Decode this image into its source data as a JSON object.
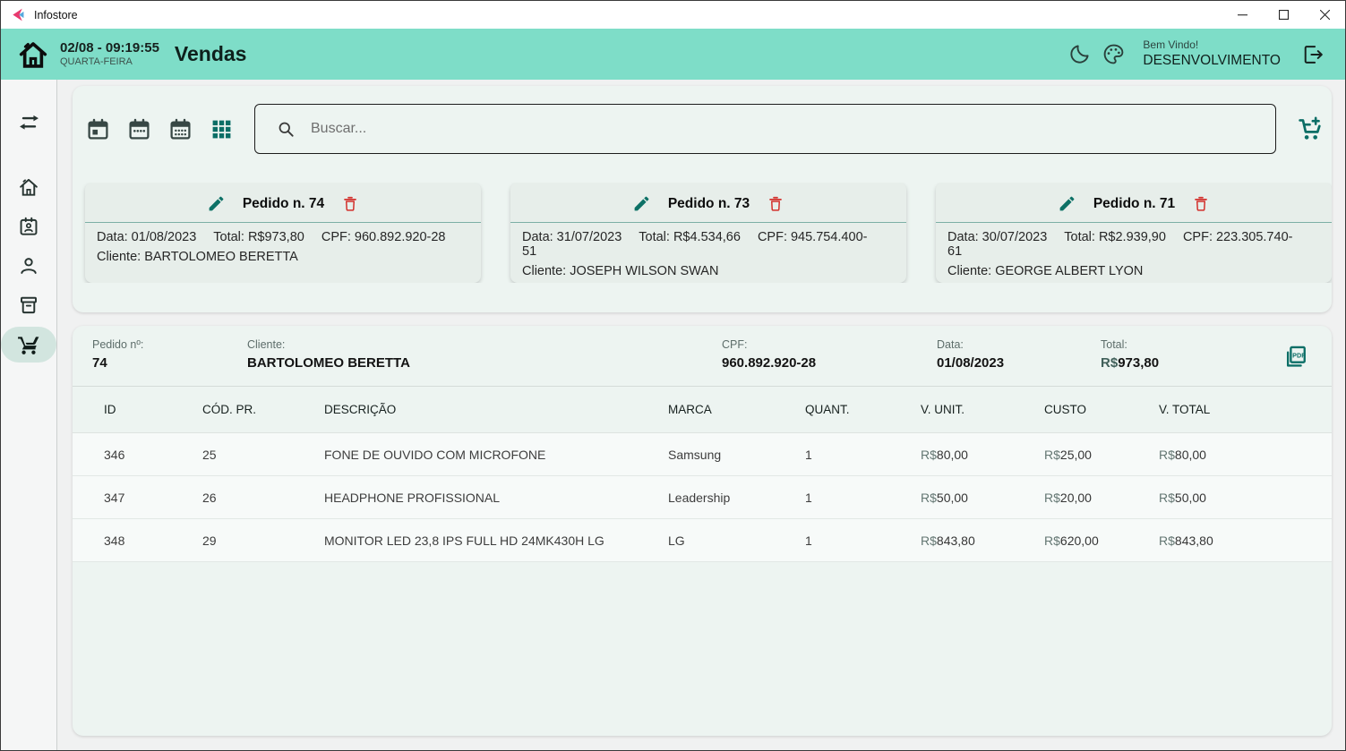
{
  "window": {
    "title": "Infostore",
    "controls": [
      "minimize",
      "maximize",
      "close"
    ]
  },
  "header": {
    "date": "02/08 - 09:19:55",
    "weekday": "QUARTA-FEIRA",
    "title": "Vendas",
    "welcome": "Bem Vindo!",
    "user": "DESENVOLVIMENTO"
  },
  "sidebar": {
    "items": [
      {
        "icon": "swap-horizontal-icon",
        "active": false
      },
      {
        "icon": "home-icon",
        "active": false
      },
      {
        "icon": "contact-badge-icon",
        "active": false
      },
      {
        "icon": "person-icon",
        "active": false
      },
      {
        "icon": "archive-box-icon",
        "active": false
      },
      {
        "icon": "shopping-cart-icon",
        "active": true
      }
    ]
  },
  "toolbar": {
    "icons": [
      "calendar-day-icon",
      "calendar-week-icon",
      "calendar-month-icon",
      "grid-icon",
      "search-icon",
      "add-cart-icon"
    ],
    "search_placeholder": "Buscar..."
  },
  "orders": [
    {
      "title": "Pedido n. 74",
      "data": "Data: 01/08/2023",
      "total": "Total: R$973,80",
      "cpf": "CPF: 960.892.920-28",
      "cliente": "Cliente: BARTOLOMEO BERETTA"
    },
    {
      "title": "Pedido n. 73",
      "data": "Data: 31/07/2023",
      "total": "Total: R$4.534,66",
      "cpf": "CPF: 945.754.400-51",
      "cliente": "Cliente: JOSEPH WILSON SWAN"
    },
    {
      "title": "Pedido n. 71",
      "data": "Data: 30/07/2023",
      "total": "Total: R$2.939,90",
      "cpf": "CPF: 223.305.740-61",
      "cliente": "Cliente: GEORGE ALBERT LYON"
    }
  ],
  "detail": {
    "pedido_label": "Pedido nº:",
    "pedido": "74",
    "cliente_label": "Cliente:",
    "cliente": "BARTOLOMEO BERETTA",
    "cpf_label": "CPF:",
    "cpf": "960.892.920-28",
    "data_label": "Data:",
    "data": "01/08/2023",
    "total_label": "Total:",
    "total_prefix": "R$",
    "total": "973,80",
    "pdf_icon": "pdf-export-icon"
  },
  "table": {
    "headers": [
      "ID",
      "CÓD. PR.",
      "DESCRIÇÃO",
      "MARCA",
      "QUANT.",
      "V. UNIT.",
      "CUSTO",
      "V. TOTAL"
    ],
    "rows": [
      {
        "id": "346",
        "cod": "25",
        "desc": "FONE DE OUVIDO COM MICROFONE",
        "marca": "Samsung",
        "quant": "1",
        "vunit_pre": "R$",
        "vunit": "80,00",
        "custo_pre": "R$",
        "custo": "25,00",
        "vtotal_pre": "R$",
        "vtotal": "80,00"
      },
      {
        "id": "347",
        "cod": "26",
        "desc": "HEADPHONE PROFISSIONAL",
        "marca": "Leadership",
        "quant": "1",
        "vunit_pre": "R$",
        "vunit": "50,00",
        "custo_pre": "R$",
        "custo": "20,00",
        "vtotal_pre": "R$",
        "vtotal": "50,00"
      },
      {
        "id": "348",
        "cod": "29",
        "desc": "MONITOR LED 23,8 IPS FULL HD 24MK430H LG",
        "marca": "LG",
        "quant": "1",
        "vunit_pre": "R$",
        "vunit": "843,80",
        "custo_pre": "R$",
        "custo": "620,00",
        "vtotal_pre": "R$",
        "vtotal": "843,80"
      }
    ]
  },
  "colors": {
    "header_teal": "#7eddc8",
    "accent_teal": "#0b6e66",
    "danger_red": "#d3302c",
    "active_pill": "#d2e5df",
    "panel_bg": "#edf4f1",
    "card_bg": "#e7eeea"
  }
}
